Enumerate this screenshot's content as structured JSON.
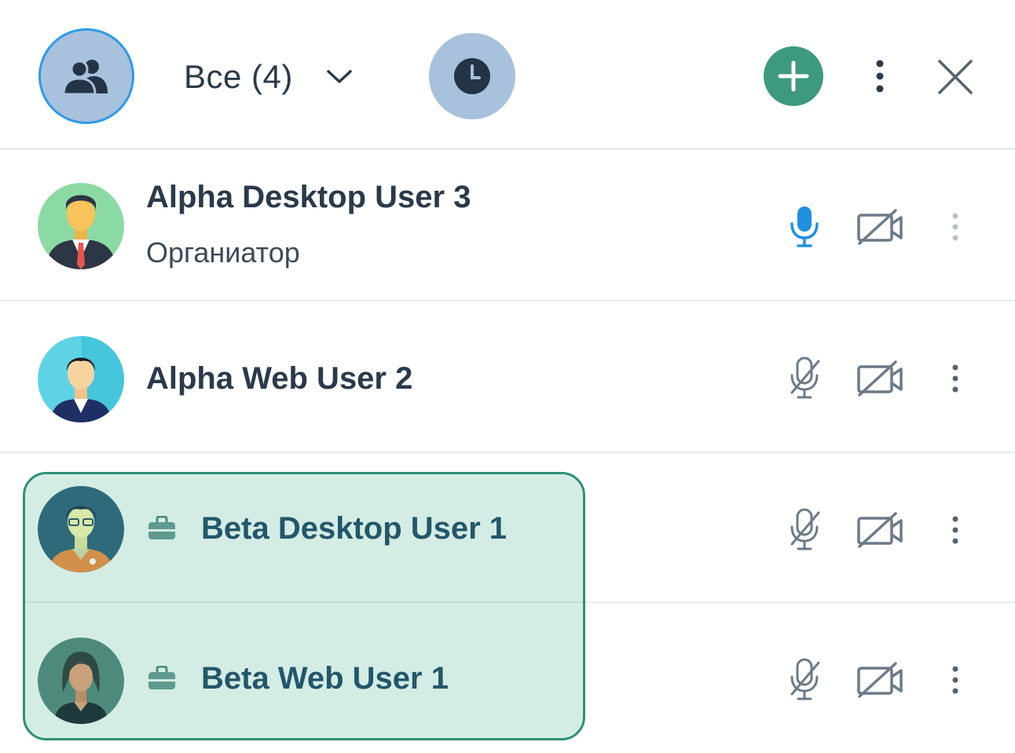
{
  "header": {
    "group_icon": "users-icon",
    "filter_label": "Все (4)",
    "filter_chevron": "chevron-down-icon",
    "history_icon": "clock-icon",
    "add_icon": "plus-icon",
    "more_icon": "more-vertical-icon",
    "close_icon": "close-icon"
  },
  "colors": {
    "accent_blue": "#2f9ae8",
    "add_green": "#3d9a7e",
    "avatar_button_bg": "#a8c1dc",
    "highlight_bg": "#d3ede5",
    "highlight_border": "#2f8f79",
    "mic_active": "#1e90e0",
    "icon_gray": "#6c7a88"
  },
  "participants": [
    {
      "name": "Alpha Desktop User 3",
      "role": "Органиатор",
      "mic": "on",
      "camera": "off",
      "avatar": "businessman-avatar"
    },
    {
      "name": "Alpha Web User 2",
      "role": "",
      "mic": "off",
      "camera": "off",
      "avatar": "man-avatar"
    },
    {
      "name": "Beta Desktop User 1",
      "role": "",
      "mic": "off",
      "camera": "off",
      "avatar": "man-glasses-avatar",
      "guest_badge": "briefcase-icon"
    },
    {
      "name": "Beta Web User 1",
      "role": "",
      "mic": "off",
      "camera": "off",
      "avatar": "woman-avatar",
      "guest_badge": "briefcase-icon"
    }
  ]
}
